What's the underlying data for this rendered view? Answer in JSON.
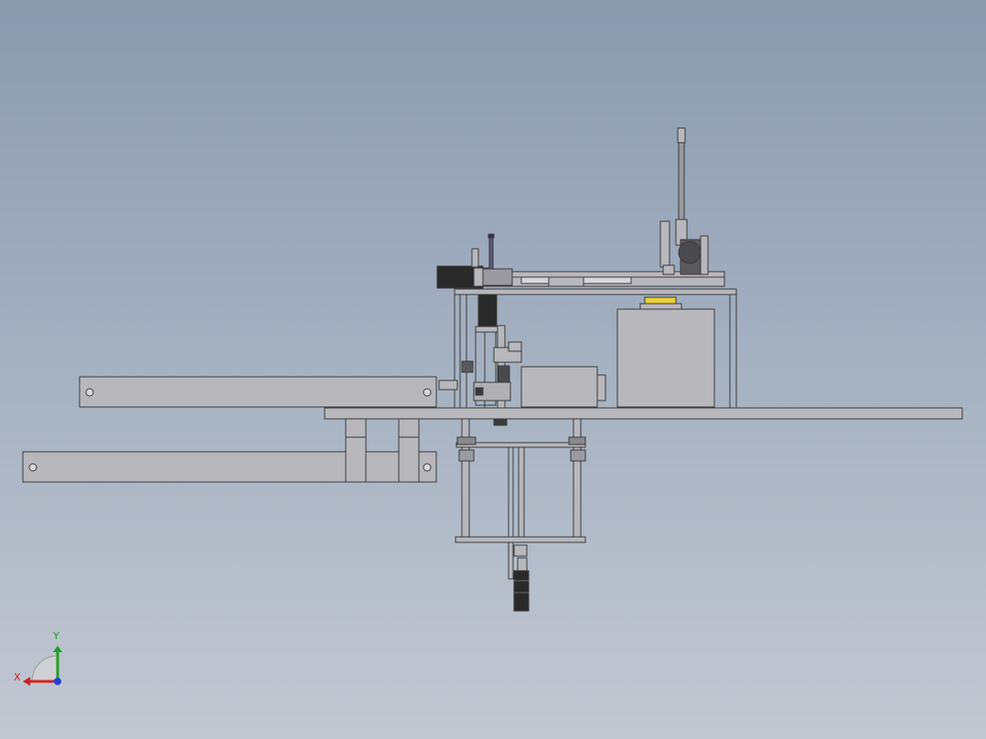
{
  "view": {
    "colors": {
      "background_top": "#8b9aae",
      "background_bottom": "#c2c8d2",
      "part_fill": "#b8b8bc",
      "part_stroke": "#3a3a3a",
      "dark_part": "#2a2a2a",
      "accent_yellow": "#e8d13a"
    }
  },
  "triad": {
    "x_label": "X",
    "y_label": "Y",
    "x_color": "#d42020",
    "y_color": "#20a020",
    "z_color": "#2040d0",
    "icon": "coordinate-triad-icon"
  }
}
